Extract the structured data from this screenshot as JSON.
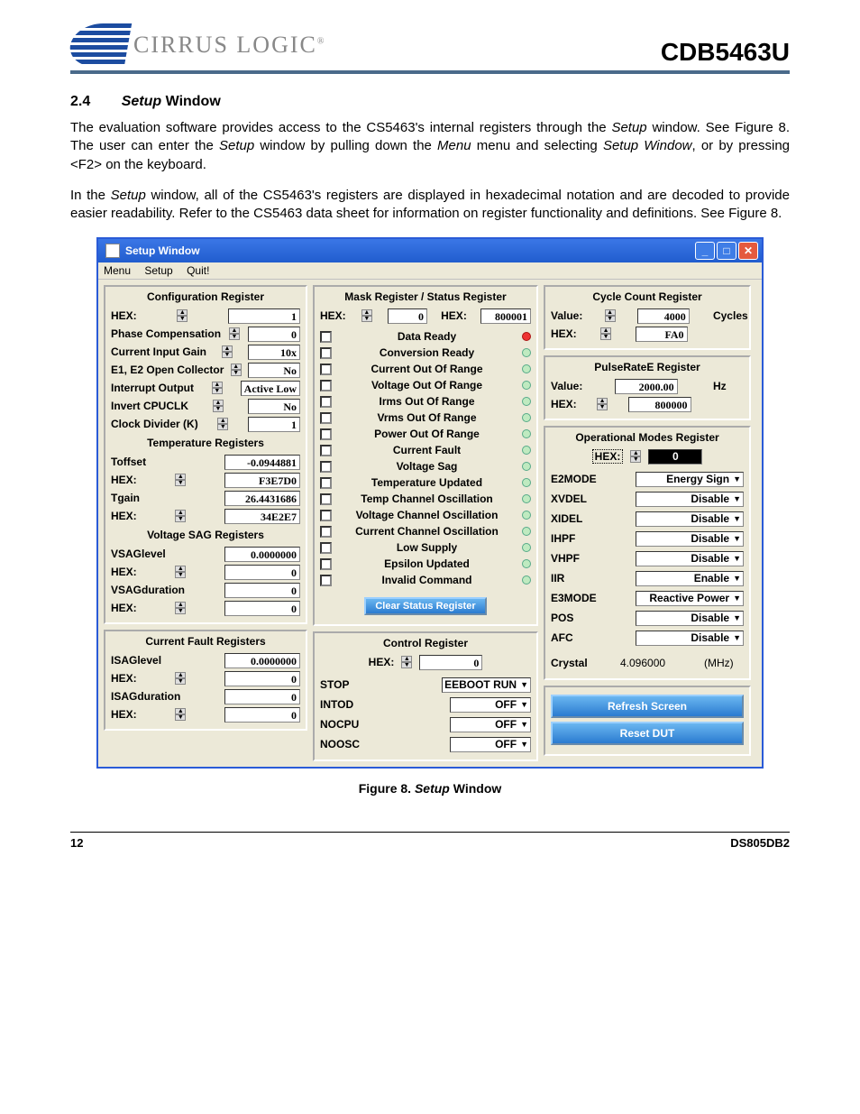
{
  "header": {
    "brand": "CIRRUS LOGIC",
    "doc_id": "CDB5463U"
  },
  "section": {
    "num": "2.4",
    "title_ital": "Setup",
    "title_rest": " Window",
    "para1a": "The evaluation software provides access to the CS5463's internal registers through the ",
    "para1b": "Setup",
    "para1c": " window. See Figure 8. The user can enter the ",
    "para1d": "Setup",
    "para1e": " window by pulling down the ",
    "para1f": "Menu",
    "para1g": " menu and selecting ",
    "para1h": "Setup Window",
    "para1i": ", or by pressing <F2> on the keyboard.",
    "para2a": "In the ",
    "para2b": "Setup",
    "para2c": " window, all of the CS5463's registers are displayed in hexadecimal notation and are decoded to provide easier readability. Refer to the CS5463 data sheet for information on register functionality and definitions. See Figure 8."
  },
  "win": {
    "title": "Setup Window",
    "menu": [
      "Menu",
      "Setup",
      "Quit!"
    ]
  },
  "config": {
    "title": "Configuration Register",
    "hexlbl": "HEX:",
    "hexval": "1",
    "rows": [
      {
        "lbl": "Phase Compensation",
        "val": "0"
      },
      {
        "lbl": "Current Input Gain",
        "val": "10x"
      },
      {
        "lbl": "E1, E2 Open Collector",
        "val": "No"
      },
      {
        "lbl": "Interrupt Output",
        "val": "Active Low"
      },
      {
        "lbl": "Invert CPUCLK",
        "val": "No"
      },
      {
        "lbl": "Clock Divider (K)",
        "val": "1"
      }
    ],
    "temp_title": "Temperature Registers",
    "temp": [
      {
        "lbl": "Toffset",
        "val": "-0.0944881"
      },
      {
        "lbl": "HEX:",
        "val": "F3E7D0"
      },
      {
        "lbl": "Tgain",
        "val": "26.4431686"
      },
      {
        "lbl": "HEX:",
        "val": "34E2E7"
      }
    ],
    "vsag_title": "Voltage SAG Registers",
    "vsag": [
      {
        "lbl": "VSAGlevel",
        "val": "0.0000000"
      },
      {
        "lbl": "HEX:",
        "val": "0"
      },
      {
        "lbl": "VSAGduration",
        "val": "0"
      },
      {
        "lbl": "HEX:",
        "val": "0"
      }
    ],
    "ifault_title": "Current Fault Registers",
    "ifault": [
      {
        "lbl": "ISAGlevel",
        "val": "0.0000000"
      },
      {
        "lbl": "HEX:",
        "val": "0"
      },
      {
        "lbl": "ISAGduration",
        "val": "0"
      },
      {
        "lbl": "HEX:",
        "val": "0"
      }
    ]
  },
  "mask": {
    "title": "Mask Register / Status Register",
    "hex1": "0",
    "hex2": "800001",
    "items": [
      {
        "lbl": "Data Ready",
        "red": true
      },
      {
        "lbl": "Conversion Ready"
      },
      {
        "lbl": "Current Out Of Range"
      },
      {
        "lbl": "Voltage Out Of Range"
      },
      {
        "lbl": "Irms Out Of Range"
      },
      {
        "lbl": "Vrms Out Of Range"
      },
      {
        "lbl": "Power Out Of Range"
      },
      {
        "lbl": "Current Fault"
      },
      {
        "lbl": "Voltage Sag"
      },
      {
        "lbl": "Temperature Updated"
      },
      {
        "lbl": "Temp Channel Oscillation"
      },
      {
        "lbl": "Voltage Channel Oscillation"
      },
      {
        "lbl": "Current Channel Oscillation"
      },
      {
        "lbl": "Low Supply"
      },
      {
        "lbl": "Epsilon Updated"
      },
      {
        "lbl": "Invalid Command"
      }
    ],
    "clear_btn": "Clear Status Register"
  },
  "control": {
    "title": "Control Register",
    "hexlbl": "HEX:",
    "hexval": "0",
    "rows": [
      {
        "lbl": "STOP",
        "val": "EEBOOT RUN"
      },
      {
        "lbl": "INTOD",
        "val": "OFF"
      },
      {
        "lbl": "NOCPU",
        "val": "OFF"
      },
      {
        "lbl": "NOOSC",
        "val": "OFF"
      }
    ]
  },
  "cycle": {
    "title": "Cycle Count Register",
    "value_lbl": "Value:",
    "value": "4000",
    "unit": "Cycles",
    "hexlbl": "HEX:",
    "hex": "FA0"
  },
  "pulse": {
    "title": "PulseRateE Register",
    "value_lbl": "Value:",
    "value": "2000.00",
    "unit": "Hz",
    "hexlbl": "HEX:",
    "hex": "800000"
  },
  "opmodes": {
    "title": "Operational Modes Register",
    "hexlbl": "HEX:",
    "hex": "0",
    "rows": [
      {
        "lbl": "E2MODE",
        "val": "Energy Sign"
      },
      {
        "lbl": "XVDEL",
        "val": "Disable"
      },
      {
        "lbl": "XIDEL",
        "val": "Disable"
      },
      {
        "lbl": "IHPF",
        "val": "Disable"
      },
      {
        "lbl": "VHPF",
        "val": "Disable"
      },
      {
        "lbl": "IIR",
        "val": "Enable"
      },
      {
        "lbl": "E3MODE",
        "val": "Reactive Power"
      },
      {
        "lbl": "POS",
        "val": "Disable"
      },
      {
        "lbl": "AFC",
        "val": "Disable"
      }
    ],
    "crystal_lbl": "Crystal",
    "crystal_val": "4.096000",
    "crystal_unit": "(MHz)"
  },
  "actions": {
    "refresh": "Refresh Screen",
    "reset": "Reset DUT"
  },
  "figcap": {
    "pre": "Figure 8.  ",
    "ital": "Setup",
    "post": " Window"
  },
  "footer": {
    "page": "12",
    "doc": "DS805DB2"
  }
}
